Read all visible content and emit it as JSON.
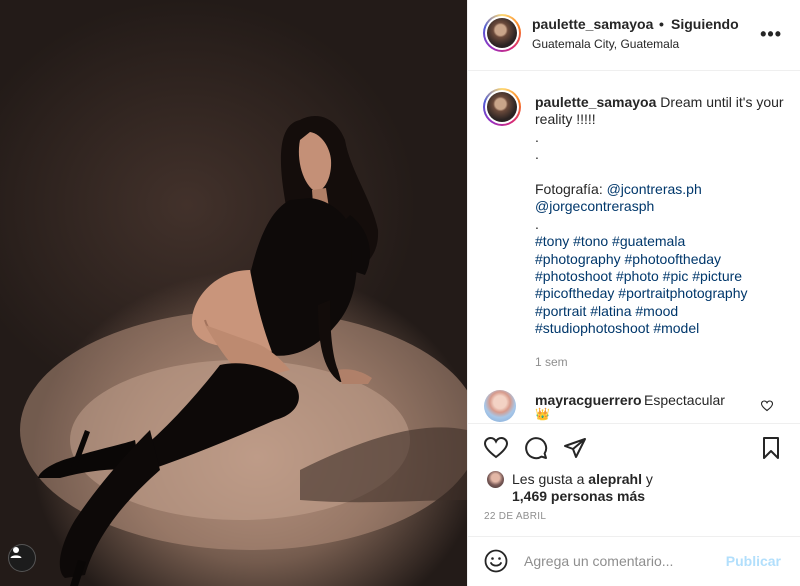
{
  "header": {
    "username": "paulette_samayoa",
    "separator": "•",
    "follow_status": "Siguiendo",
    "location": "Guatemala City, Guatemala",
    "more_icon": "more-horizontal-icon",
    "more_glyph": "•••"
  },
  "caption": {
    "username": "paulette_samayoa",
    "text_1": "Dream until it's your reality !!!!!",
    "dot_1": ".",
    "dot_2": ".",
    "photo_label": "Fotografía:",
    "mention_1": "@jcontreras.ph",
    "mention_2": "@jorgecontrerasph",
    "dot_3": ".",
    "hashtags_line_1": "#tony #tono #guatemala",
    "hashtags_line_2": "#photography #photooftheday",
    "hashtags_line_3": "#photoshoot #photo #pic #picture",
    "hashtags_line_4": "#picoftheday #portraitphotography",
    "hashtags_line_5": "#portrait #latina #mood",
    "hashtags_line_6": "#studiophotoshoot #model",
    "time_ago": "1 sem"
  },
  "comment": {
    "username": "mayracguerrero",
    "text": "Espectacular",
    "emoji": "👑",
    "like_icon": "heart-outline-icon"
  },
  "actions": {
    "like_icon": "heart-icon",
    "comment_icon": "comment-icon",
    "share_icon": "paper-plane-icon",
    "save_icon": "bookmark-icon"
  },
  "likes": {
    "prefix": "Les gusta a",
    "user": "aleprahl",
    "conjunction": "y",
    "count_text": "1,469 personas más"
  },
  "date": "22 DE ABRIL",
  "comment_box": {
    "emoji_icon": "smiley-icon",
    "placeholder": "Agrega un comentario...",
    "submit_label": "Publicar"
  },
  "colors": {
    "link": "#00376b",
    "muted": "#8e8e8e",
    "publish_disabled": "#b2dffc",
    "text": "#262626"
  }
}
